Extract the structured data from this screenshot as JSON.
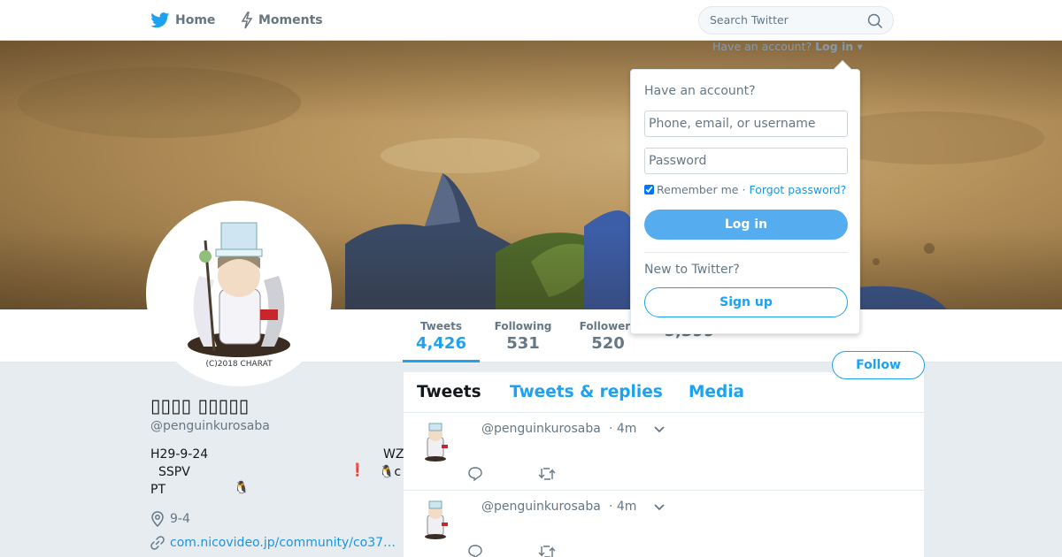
{
  "nav": {
    "home_label": "Home",
    "moments_label": "Moments",
    "search_placeholder": "Search Twitter"
  },
  "account_prompt": {
    "text": "Have an account?",
    "login_link": "Log in ▾"
  },
  "stats": [
    {
      "label": "Tweets",
      "value": "4,426"
    },
    {
      "label": "Following",
      "value": "531"
    },
    {
      "label": "Followers",
      "value": "520"
    },
    {
      "label": "",
      "value": "5,399"
    }
  ],
  "follow_label": "Follow",
  "profile": {
    "name": "▯▯▯▯ ▯▯▯▯▯",
    "handle": "@penguinkurosaba",
    "bio": {
      "line1_a": "H29-9-24",
      "line1_b": "WZ",
      "line2_a": "SSPV",
      "line2_b": "❗",
      "line2_c": "🐧c",
      "line3_a": "PT",
      "line3_b": "🐧"
    },
    "location": "9-4",
    "url": "com.nicovideo.jp/community/co37…"
  },
  "timeline": {
    "tabs": [
      "Tweets",
      "Tweets & replies",
      "Media"
    ],
    "tweets": [
      {
        "handle": "@penguinkurosaba",
        "time": "· 4m"
      },
      {
        "handle": "@penguinkurosaba",
        "time": "· 4m"
      }
    ]
  },
  "login": {
    "title": "Have an account?",
    "username_placeholder": "Phone, email, or username",
    "password_placeholder": "Password",
    "remember": "Remember me",
    "separator": "·",
    "forgot": "Forgot password?",
    "login_button": "Log in",
    "new_title": "New to Twitter?",
    "signup_button": "Sign up"
  },
  "colors": {
    "accent": "#1da1f2",
    "link": "#1b95e0",
    "login_button": "#55acee",
    "background": "#e6ecf0"
  },
  "icons": [
    "twitter-bird-icon",
    "lightning-icon",
    "search-icon",
    "location-pin-icon",
    "link-icon",
    "chevron-down-icon",
    "reply-icon",
    "retweet-icon"
  ]
}
